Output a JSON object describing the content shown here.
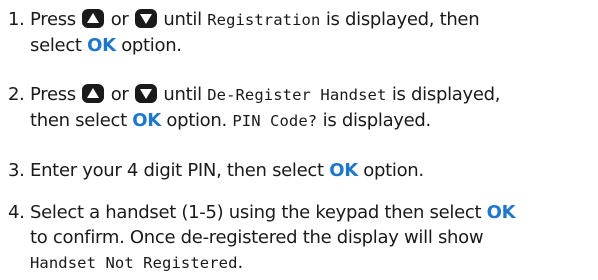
{
  "colors": {
    "accent": "#1f77c9",
    "text": "#1a1a1a",
    "button": "#1a1a1a"
  },
  "icons": {
    "up": "up-arrow-button-icon",
    "down": "down-arrow-button-icon"
  },
  "steps": [
    {
      "number": "1.",
      "press": "Press",
      "or": "or",
      "until": "until",
      "screen": "Registration",
      "after": "is displayed, then",
      "select": "select",
      "ok": "OK",
      "option": "option."
    },
    {
      "number": "2.",
      "press": "Press",
      "or": "or",
      "until": "until",
      "screen": "De-Register Handset",
      "after": "is displayed,",
      "then_select": "then select",
      "ok": "OK",
      "option": "option.",
      "screen2": "PIN Code?",
      "after2": "is displayed."
    },
    {
      "number": "3.",
      "text": "Enter your 4 digit PIN, then select",
      "ok": "OK",
      "option": "option."
    },
    {
      "number": "4.",
      "text": "Select a handset (1-5) using the keypad then select",
      "ok": "OK",
      "line2": "to confirm. Once de-registered the display will show",
      "screen": "Handset Not Registered",
      "end": "."
    }
  ]
}
